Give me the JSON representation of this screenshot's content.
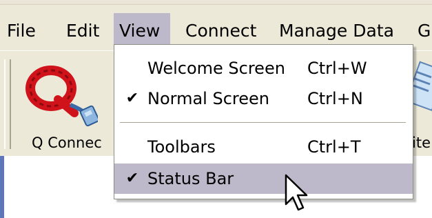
{
  "menubar": {
    "items": [
      {
        "label": "File"
      },
      {
        "label": "Edit"
      },
      {
        "label": "View"
      },
      {
        "label": "Connect"
      },
      {
        "label": "Manage Data"
      },
      {
        "label": "G"
      }
    ]
  },
  "toolbar": {
    "buttons": [
      {
        "label": "Q Connec",
        "icon": "q-connect-icon"
      },
      {
        "label": "ite",
        "icon": "site-icon"
      }
    ]
  },
  "view_menu": {
    "items": [
      {
        "label": "Welcome Screen",
        "shortcut": "Ctrl+W",
        "checked": false
      },
      {
        "label": "Normal Screen",
        "shortcut": "Ctrl+N",
        "checked": true
      },
      {
        "label": "Toolbars",
        "shortcut": "Ctrl+T",
        "checked": false
      },
      {
        "label": "Status Bar",
        "shortcut": "",
        "checked": true,
        "highlighted": true
      }
    ],
    "check_glyph": "✔"
  },
  "colors": {
    "menu_bg": "#ece9d8",
    "highlight": "#bdb8ca",
    "window_border": "#5f77b8"
  }
}
